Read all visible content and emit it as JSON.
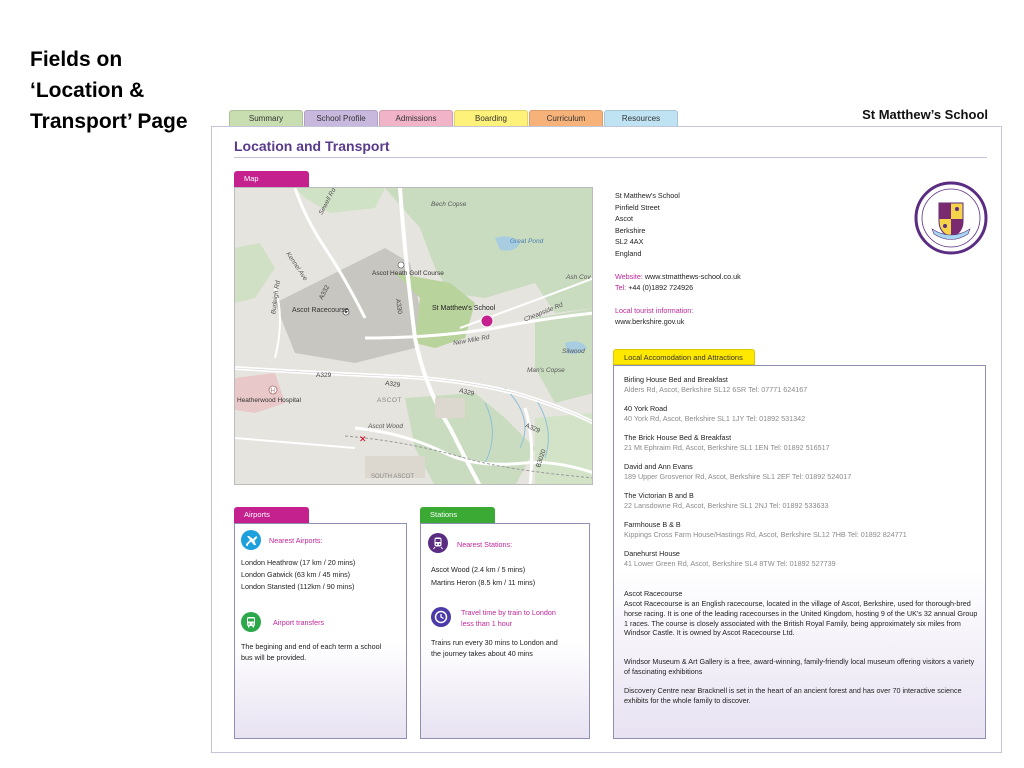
{
  "slide_title": "Fields on ‘Location & Transport’ Page",
  "nav": {
    "tabs": [
      {
        "label": "Summary",
        "color": "#c8ddb0"
      },
      {
        "label": "School Profile",
        "color": "#c9b8de"
      },
      {
        "label": "Admissions",
        "color": "#f0b3c8"
      },
      {
        "label": "Boarding",
        "color": "#fff27a"
      },
      {
        "label": "Curriculum",
        "color": "#f7b27a"
      },
      {
        "label": "Resources",
        "color": "#bfe3f2"
      }
    ],
    "school_name": "St Matthew’s School"
  },
  "page_heading": "Location and Transport",
  "map": {
    "tab_label": "Map",
    "marker_label": "St Matthew's School",
    "labels": {
      "bech_copse": "Bech Copse",
      "great_pond": "Great Pond",
      "golf": "Ascot Heath Golf Course",
      "racecourse": "Ascot Racecourse",
      "ash_cov": "Ash Cov",
      "new_mile": "New Mile Rd",
      "mans_copse": "Man's Copse",
      "a329_1": "A329",
      "a329_2": "A329",
      "a329_3": "A329",
      "a329_4": "A329",
      "a332": "A332",
      "a330": "A330",
      "heatherwood": "Heatherwood Hospital",
      "ascot": "ASCOT",
      "ascot_wood": "Ascot Wood",
      "south_ascot": "SOUTH ASCOT",
      "b3020": "B3020",
      "sweet_rd": "Sewell Rd",
      "burleigh": "Burleigh Rd",
      "kennel": "Kennel Ave",
      "silwood": "Silwood",
      "cheapside": "Cheapside Rd"
    }
  },
  "address": {
    "lines": [
      "St Matthew's School",
      "Pinfield Street",
      "Ascot",
      "Berkshire",
      "SL2 4AX",
      "England"
    ],
    "website_label": "Website:",
    "website": "www.stmatthews-school.co.uk",
    "tel_label": "Tel:",
    "tel": "+44 (0)1892 724926",
    "tourist_label": "Local tourist information:",
    "tourist_url": "www.berkshire.gov.uk"
  },
  "airports": {
    "tab_label": "Airports",
    "nearest_label": "Nearest Airports:",
    "items": [
      "London Heathrow  (17 km / 20 mins)",
      "London Gatwick  (63 km / 45 mins)",
      "London Stansted  (112km / 90 mins)"
    ],
    "transfers_label": "Airport transfers",
    "transfers_text_1": "The begining and end of each term a school",
    "transfers_text_2": "bus will be provided."
  },
  "stations": {
    "tab_label": "Stations",
    "nearest_label": "Nearest Stations:",
    "items": [
      "Ascot Wood (2.4 km / 5 mins)",
      "Martins Heron (8.5 km /  11 mins)"
    ],
    "travel_label_1": "Travel time by train to London",
    "travel_label_2": "less than 1 hour",
    "travel_text_1": "Trains run every 30 mins to London and",
    "travel_text_2": "the journey takes about 40 mins"
  },
  "accommodation": {
    "tab_label": "Local Accomodation and Attractions",
    "items": [
      {
        "name": "Birling House Bed and Breakfast",
        "detail": "Alders Rd, Ascot, Berkshire SL12 6SR    Tel: 07771 624167"
      },
      {
        "name": "40 York Road",
        "detail": "40 York Rd,  Ascot, Berkshire SL1 1JY    Tel: 01892 531342"
      },
      {
        "name": "The Brick House Bed & Breakfast",
        "detail": "21 Mt Ephraim Rd,  Ascot, Berkshire SL1 1EN    Tel: 01892 516517"
      },
      {
        "name": "David and Ann Evans",
        "detail": "189 Upper Grosvenor Rd,  Ascot, Berkshire SL1 2EF    Tel: 01892 524017"
      },
      {
        "name": "The Victorian B and B",
        "detail": "22 Lansdowne Rd,  Ascot, Berkshire SL1 2NJ    Tel: 01892 533633"
      },
      {
        "name": "Farmhouse B & B",
        "detail": "Kippings Cross Farm House/Hastings Rd,  Ascot, Berkshire SL12 7HB    Tel: 01892 824771"
      },
      {
        "name": "Danehurst House",
        "detail": "41 Lower Green Rd,  Ascot, Berkshire SL4 8TW    Tel: 01892 527739"
      }
    ],
    "racecourse_title": "Ascot Racecourse",
    "racecourse_text": "Ascot Racecourse  is an English racecourse, located in the village of Ascot, Berkshire, used for thorough-bred horse racing. It is one of the leading racecourses in the United Kingdom, hosting 9 of the UK's 32 annual Group 1 races. The course is closely associated with the British Royal Family, being approximately six miles from Windsor Castle. It is owned by Ascot Racecourse Ltd.",
    "museum_text": "Windsor Museum & Art Gallery is a free, award-winning, family-friendly local museum offering visitors a variety of fascinating exhibitions",
    "discovery_text": "Discovery Centre near Bracknell is set in the heart of an ancient forest and has over 70 interactive science exhibits for the whole family to discover."
  },
  "colors": {
    "heading": "#5a3a8a",
    "magenta": "#c4218f",
    "green": "#3aaa35",
    "yellow": "#ffe800",
    "airport_icon": "#1ea0dc",
    "transfer_icon": "#2aa84a",
    "train_icon": "#5a2d82",
    "clock_icon": "#4b3aa8"
  }
}
